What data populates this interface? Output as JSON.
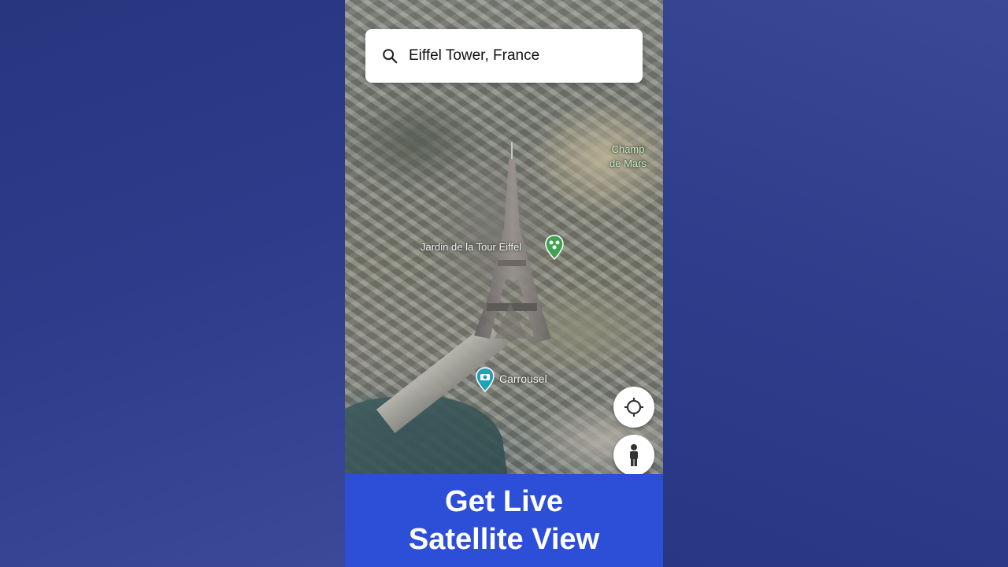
{
  "search": {
    "query": "Eiffel Tower, France",
    "icon": "search-icon"
  },
  "map": {
    "labels": {
      "champ_line1": "Champ",
      "champ_line2": "de Mars",
      "jardin": "Jardin de la Tour Eiffel",
      "carrousel": "Carrousel"
    },
    "pins": {
      "jardin": {
        "icon": "park-pin-icon",
        "color": "#3fa34d"
      },
      "carrousel": {
        "icon": "attraction-pin-icon",
        "color": "#1ea2b8"
      }
    }
  },
  "controls": {
    "locate_icon": "my-location-icon",
    "street_view_icon": "street-view-person-icon"
  },
  "caption": {
    "line1": "Get Live",
    "line2": "Satellite View",
    "background": "#2d4fd8"
  },
  "colors": {
    "page_background": "#2e3d8c"
  }
}
